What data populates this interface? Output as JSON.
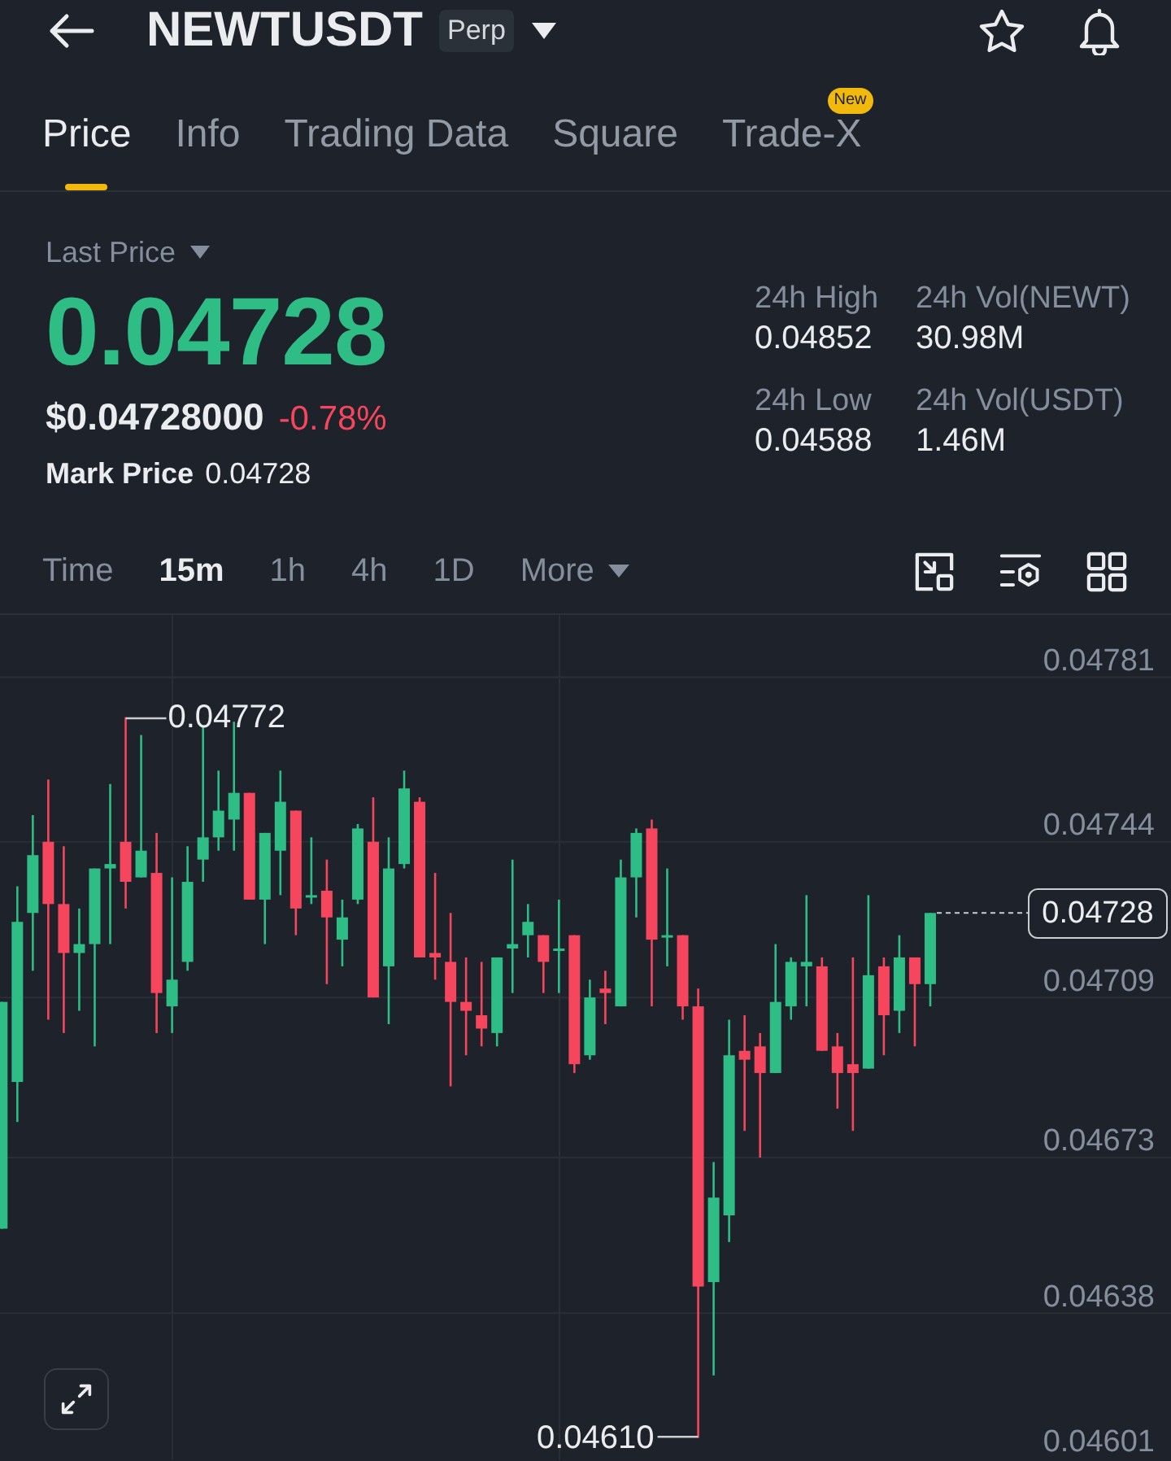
{
  "header": {
    "title": "NEWTUSDT",
    "badge": "Perp"
  },
  "tabs": [
    {
      "label": "Price",
      "selected": true
    },
    {
      "label": "Info",
      "selected": false
    },
    {
      "label": "Trading Data",
      "selected": false
    },
    {
      "label": "Square",
      "selected": false
    },
    {
      "label": "Trade-X",
      "selected": false,
      "badge": "New"
    }
  ],
  "price_panel": {
    "label": "Last Price",
    "last_price": {
      "value": "0.04728",
      "rising": true
    },
    "usd_price": "$0.04728000",
    "change": {
      "value": "-0.78%",
      "rising": false
    },
    "mark_label": "Mark Price",
    "mark_price": "0.04728"
  },
  "stats": [
    {
      "label": "24h High",
      "value": "0.04852"
    },
    {
      "label": "24h Vol(NEWT)",
      "value": "30.98M"
    },
    {
      "label": "24h Low",
      "value": "0.04588"
    },
    {
      "label": "24h Vol(USDT)",
      "value": "1.46M"
    }
  ],
  "intervals": [
    {
      "label": "Time",
      "kind": "option",
      "selected": false
    },
    {
      "label": "15m",
      "kind": "option",
      "selected": true
    },
    {
      "label": "1h",
      "kind": "option",
      "selected": false
    },
    {
      "label": "4h",
      "kind": "option",
      "selected": false
    },
    {
      "label": "1D",
      "kind": "option",
      "selected": false
    },
    {
      "label": "More",
      "kind": "menu",
      "selected": false
    }
  ],
  "chart": {
    "chart_data": {
      "type": "candlestick",
      "categories": [
        null,
        null,
        null,
        null,
        null,
        null,
        null,
        null,
        null,
        null,
        null,
        null,
        null,
        null,
        null,
        null,
        null,
        null,
        null,
        null,
        null,
        null,
        null,
        null,
        null,
        null,
        null,
        null,
        null,
        null,
        null,
        null,
        null,
        null,
        null,
        null,
        null,
        null,
        null,
        null,
        null,
        null,
        null,
        null,
        null,
        null,
        null,
        null,
        null,
        null,
        null,
        null,
        null,
        null,
        null,
        null,
        null,
        null,
        null,
        null,
        null
      ],
      "ohlc": [
        [
          0.04657,
          0.04708,
          0.04657,
          0.04708
        ],
        [
          0.0469,
          0.04734,
          0.04681,
          0.04726
        ],
        [
          0.04728,
          0.0475,
          0.04715,
          0.04741
        ],
        [
          0.04744,
          0.04758,
          0.04704,
          0.0473
        ],
        [
          0.0473,
          0.04743,
          0.04701,
          0.04719
        ],
        [
          0.04719,
          0.04729,
          0.04706,
          0.04721
        ],
        [
          0.04721,
          0.04738,
          0.04698,
          0.04738
        ],
        [
          0.04738,
          0.04757,
          0.04721,
          0.04739
        ],
        [
          0.04744,
          0.04772,
          0.04729,
          0.04735
        ],
        [
          0.04736,
          0.04768,
          0.04736,
          0.04742
        ],
        [
          0.04737,
          0.04746,
          0.04701,
          0.0471
        ],
        [
          0.04707,
          0.04736,
          0.04701,
          0.04713
        ],
        [
          0.04717,
          0.04743,
          0.04715,
          0.04735
        ],
        [
          0.0474,
          0.0477,
          0.04735,
          0.04745
        ],
        [
          0.04745,
          0.0476,
          0.04742,
          0.04751
        ],
        [
          0.04749,
          0.04771,
          0.04742,
          0.04755
        ],
        [
          0.04755,
          0.04755,
          0.04731,
          0.04731
        ],
        [
          0.04731,
          0.04746,
          0.04721,
          0.04746
        ],
        [
          0.04742,
          0.0476,
          0.04732,
          0.04753
        ],
        [
          0.04751,
          0.04751,
          0.04723,
          0.04729
        ],
        [
          0.04732,
          0.04745,
          0.0473,
          0.04732
        ],
        [
          0.04733,
          0.0474,
          0.04712,
          0.04727
        ],
        [
          0.04722,
          0.04731,
          0.04716,
          0.04727
        ],
        [
          0.04731,
          0.04748,
          0.0473,
          0.04747
        ],
        [
          0.04744,
          0.04754,
          0.04709,
          0.04709
        ],
        [
          0.04716,
          0.04745,
          0.04703,
          0.04738
        ],
        [
          0.04739,
          0.0476,
          0.04738,
          0.04756
        ],
        [
          0.04753,
          0.04754,
          0.04718,
          0.04718
        ],
        [
          0.04719,
          0.04737,
          0.04713,
          0.04718
        ],
        [
          0.04717,
          0.04728,
          0.04689,
          0.04708
        ],
        [
          0.04708,
          0.04718,
          0.04696,
          0.04706
        ],
        [
          0.04705,
          0.04717,
          0.04698,
          0.04702
        ],
        [
          0.04701,
          0.04718,
          0.04698,
          0.04718
        ],
        [
          0.0472,
          0.0474,
          0.0471,
          0.04721
        ],
        [
          0.04723,
          0.0473,
          0.04718,
          0.04726
        ],
        [
          0.04723,
          0.04723,
          0.0471,
          0.04717
        ],
        [
          0.0472,
          0.04731,
          0.0471,
          0.0472
        ],
        [
          0.04723,
          0.04723,
          0.04692,
          0.04694
        ],
        [
          0.04696,
          0.04713,
          0.04695,
          0.04709
        ],
        [
          0.04711,
          0.04715,
          0.04703,
          0.0471
        ],
        [
          0.04707,
          0.0474,
          0.04707,
          0.04736
        ],
        [
          0.04736,
          0.04747,
          0.04727,
          0.04746
        ],
        [
          0.04747,
          0.04749,
          0.04707,
          0.04722
        ],
        [
          0.04723,
          0.04738,
          0.04716,
          0.04723
        ],
        [
          0.04723,
          0.04723,
          0.04704,
          0.04707
        ],
        [
          0.04707,
          0.04711,
          0.0461,
          0.04644
        ],
        [
          0.04645,
          0.04672,
          0.04624,
          0.04664
        ],
        [
          0.0466,
          0.04704,
          0.04654,
          0.04696
        ],
        [
          0.04697,
          0.04705,
          0.04679,
          0.04695
        ],
        [
          0.04698,
          0.04701,
          0.04673,
          0.04692
        ],
        [
          0.04692,
          0.04721,
          0.04692,
          0.04708
        ],
        [
          0.04707,
          0.04718,
          0.04704,
          0.04717
        ],
        [
          0.04716,
          0.04732,
          0.04707,
          0.04717
        ],
        [
          0.04716,
          0.04718,
          0.04697,
          0.04697
        ],
        [
          0.04698,
          0.04701,
          0.04684,
          0.04692
        ],
        [
          0.04694,
          0.04718,
          0.04679,
          0.04692
        ],
        [
          0.04693,
          0.04732,
          0.04693,
          0.04714
        ],
        [
          0.04716,
          0.04718,
          0.04696,
          0.04705
        ],
        [
          0.04706,
          0.04723,
          0.04701,
          0.04718
        ],
        [
          0.04718,
          0.04718,
          0.04698,
          0.04712
        ],
        [
          0.04712,
          0.04728,
          0.04707,
          0.04728
        ]
      ],
      "ylim": [
        0.04601,
        0.04795
      ],
      "yticks": [
        0.04781,
        0.04744,
        0.04709,
        0.04673,
        0.04638,
        0.04601
      ],
      "grid": true
    },
    "high_label": "0.04772",
    "low_label": "0.04610",
    "price_tag": "0.04728"
  }
}
